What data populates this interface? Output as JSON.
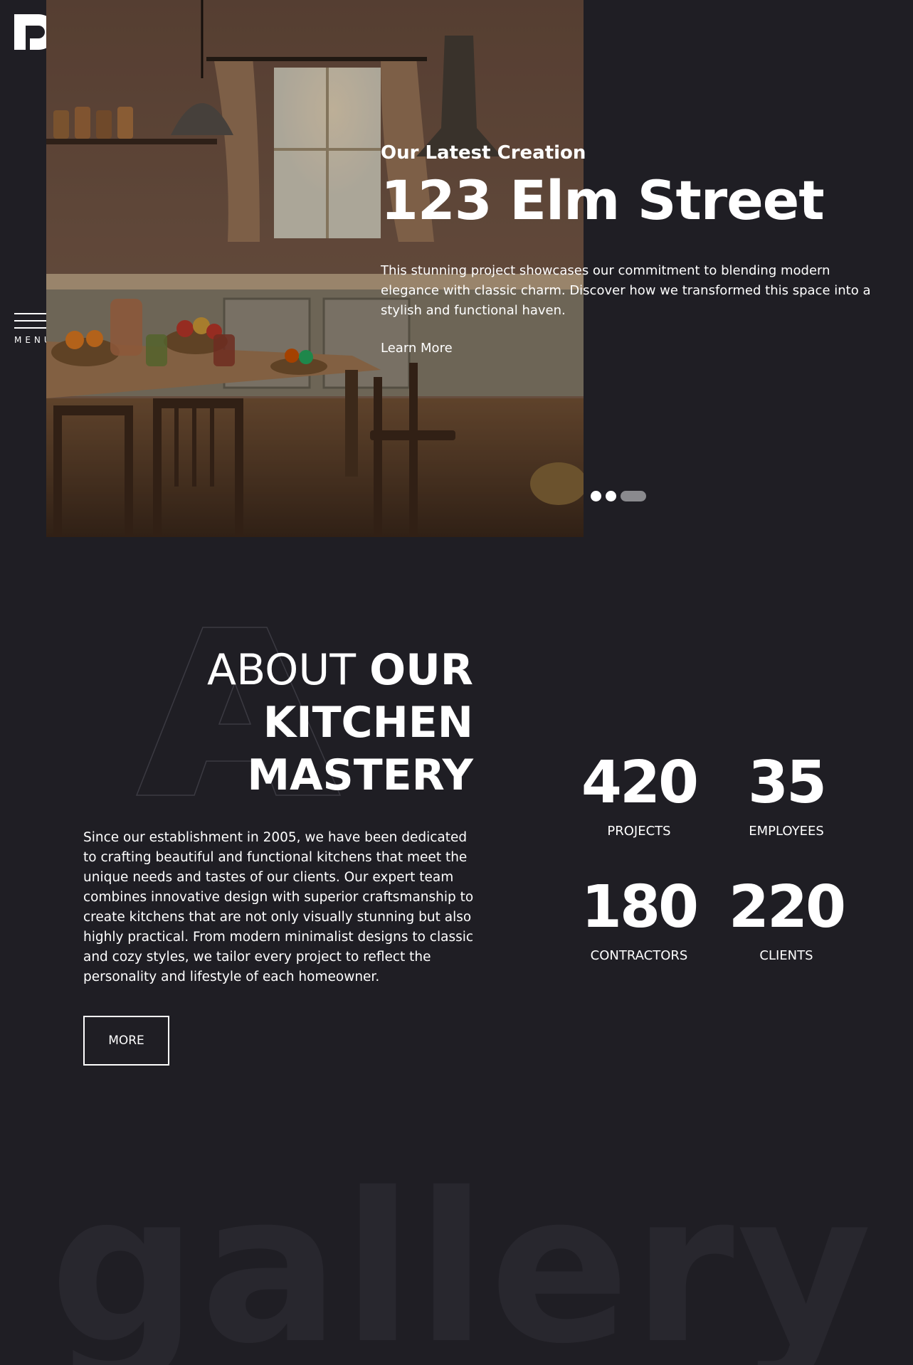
{
  "brand": {
    "logo_icon": "letter-p-logo-icon"
  },
  "menu": {
    "label": "MENU",
    "icon": "hamburger-icon"
  },
  "hero": {
    "kicker": "Our Latest Creation",
    "title": "123 Elm Street",
    "description": "This stunning project showcases our commitment to blending modern elegance with classic charm. Discover how we transformed this space into a stylish and functional haven.",
    "link": "Learn More",
    "slides_count": 3,
    "active_slide": 3
  },
  "about": {
    "heading_thin": "ABOUT",
    "heading_bold_1": "OUR",
    "heading_bold_2": "KITCHEN",
    "heading_bold_3": "MASTERY",
    "ghost_letter": "A",
    "body": "Since our establishment in 2005, we have been dedicated to crafting beautiful and functional kitchens that meet the unique needs and tastes of our clients. Our expert team combines innovative design with superior craftsmanship to create kitchens that are not only visually stunning but also highly practical. From modern minimalist designs to classic and cozy styles, we tailor every project to reflect the personality and lifestyle of each homeowner.",
    "more_button": "MORE"
  },
  "stats": [
    {
      "value": "420",
      "label": "PROJECTS"
    },
    {
      "value": "35",
      "label": "EMPLOYEES"
    },
    {
      "value": "180",
      "label": "CONTRACTORS"
    },
    {
      "value": "220",
      "label": "CLIENTS"
    }
  ],
  "gallery": {
    "ghost_title": "gallery"
  },
  "colors": {
    "background": "#1f1e24",
    "text": "#ffffff",
    "ghost_text": "#28272e",
    "dot_active": "#8a8a8e"
  }
}
